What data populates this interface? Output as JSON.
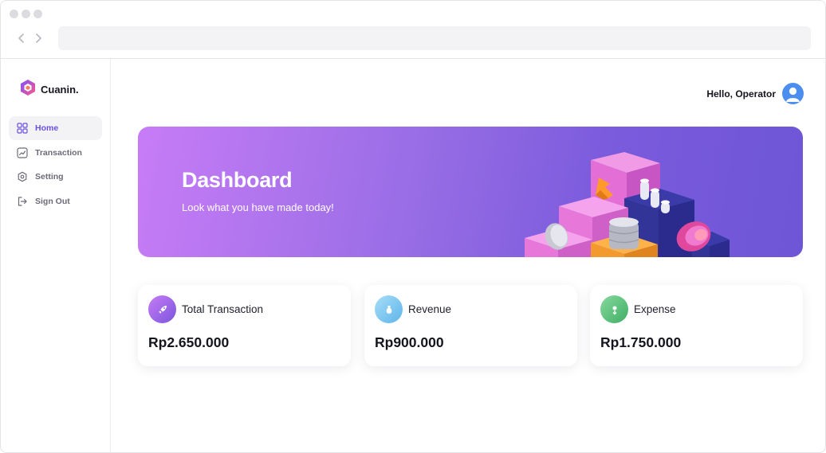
{
  "brand": {
    "name": "Cuanin.",
    "colors": {
      "accent": "#6a4fe0",
      "logo_a": "#7c4dff",
      "logo_b": "#ff5a8a"
    }
  },
  "sidebar": {
    "items": [
      {
        "label": "Home",
        "icon": "grid-icon",
        "active": true
      },
      {
        "label": "Transaction",
        "icon": "chart-line-icon",
        "active": false
      },
      {
        "label": "Setting",
        "icon": "gear-icon",
        "active": false
      },
      {
        "label": "Sign Out",
        "icon": "sign-out-icon",
        "active": false
      }
    ]
  },
  "header": {
    "greeting": "Hello, Operator",
    "avatar_icon": "user-avatar-icon"
  },
  "banner": {
    "title": "Dashboard",
    "subtitle": "Look what you have made today!",
    "gradient": [
      "#c77cf6",
      "#6d56d6"
    ]
  },
  "stats": [
    {
      "title": "Total Transaction",
      "value": "Rp2.650.000",
      "icon": "rocket-icon",
      "color": "#a467e8"
    },
    {
      "title": "Revenue",
      "value": "Rp900.000",
      "icon": "money-bag-icon",
      "color": "#79c8ef"
    },
    {
      "title": "Expense",
      "value": "Rp1.750.000",
      "icon": "money-out-icon",
      "color": "#55c07a"
    }
  ]
}
